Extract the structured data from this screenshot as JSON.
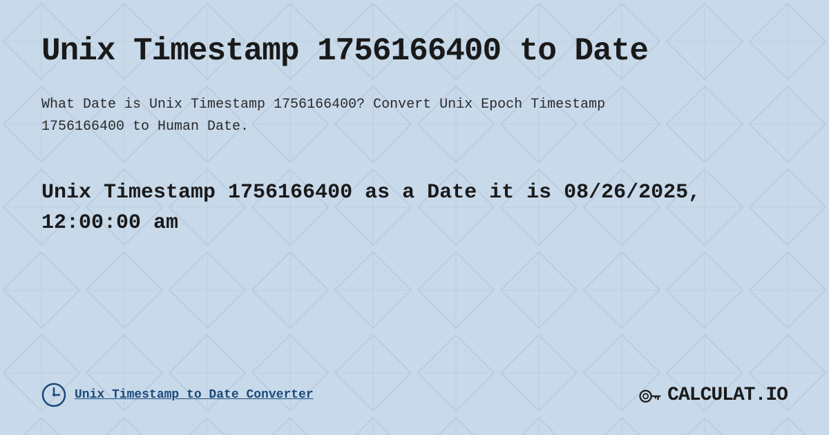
{
  "page": {
    "title": "Unix Timestamp 1756166400 to Date",
    "description": "What Date is Unix Timestamp 1756166400? Convert Unix Epoch Timestamp 1756166400 to Human Date.",
    "result": "Unix Timestamp 1756166400 as a Date it is 08/26/2025, 12:00:00 am",
    "footer_link": "Unix Timestamp to Date Converter",
    "logo_text": "CALCULAT.IO",
    "colors": {
      "background": "#c8d9ea",
      "title": "#1a1a1a",
      "description": "#2a2a2a",
      "result": "#1a1a1a",
      "link": "#1a4a7a"
    }
  }
}
